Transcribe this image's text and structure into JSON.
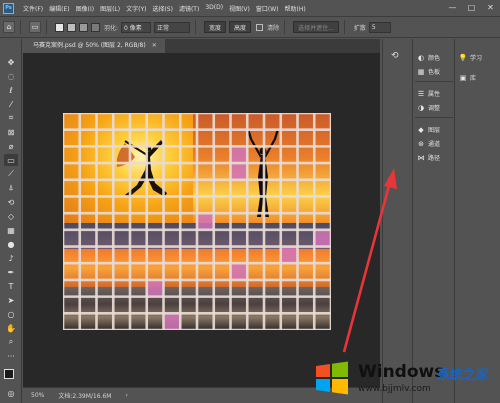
{
  "app": {
    "logo": "Ps"
  },
  "menu": [
    "文件(F)",
    "编辑(E)",
    "图像(I)",
    "图层(L)",
    "文字(Y)",
    "选择(S)",
    "滤镜(T)",
    "3D(D)",
    "视图(V)",
    "窗口(W)",
    "帮助(H)"
  ],
  "window_controls": [
    "—",
    "□",
    "✕"
  ],
  "options_bar": {
    "feather_label": "羽化:",
    "feather_value": "0 像素",
    "style_value": "正常",
    "width_label": "宽度",
    "height_label": "高度",
    "clear_label": "清除",
    "select_subject": "选择并遮住...",
    "expand_label": "扩散",
    "expand_value": "5"
  },
  "document_tab": {
    "title": "马赛克案例.psd @ 50% (图层 2, RGB/8)",
    "close": "✕"
  },
  "tools": [
    "move-tool",
    "marquee-tool",
    "lasso-tool",
    "magic-wand-tool",
    "crop-tool",
    "frame-tool",
    "eyedropper-tool",
    "brush-tool",
    "healing-tool",
    "clone-stamp-tool",
    "history-brush-tool",
    "eraser-tool",
    "gradient-tool",
    "blur-tool",
    "dodge-tool",
    "pen-tool",
    "type-tool",
    "path-select-tool",
    "shape-tool",
    "hand-tool",
    "zoom-tool",
    "more-tools"
  ],
  "panels": {
    "group1": [
      {
        "icon": "color-icon",
        "label": "颜色"
      },
      {
        "icon": "swatches-icon",
        "label": "色板"
      }
    ],
    "group2": [
      {
        "icon": "properties-icon",
        "label": "属性"
      },
      {
        "icon": "adjustments-icon",
        "label": "调整"
      }
    ],
    "group3": [
      {
        "icon": "layers-icon",
        "label": "图层"
      },
      {
        "icon": "channels-icon",
        "label": "通道"
      },
      {
        "icon": "paths-icon",
        "label": "路径"
      }
    ],
    "group4": [
      {
        "icon": "learn-icon",
        "label": "学习"
      },
      {
        "icon": "libraries-icon",
        "label": "库"
      }
    ]
  },
  "status_bar": {
    "zoom": "50%",
    "doc_info": "文档:2.39M/16.6M",
    "arrow": "›"
  },
  "watermark": {
    "title": "Windows",
    "subtitle": "系统之家",
    "url": "www.bjjmlv.com"
  },
  "colors": {
    "ui_bg": "#535353",
    "canvas_bg": "#282828",
    "arrow": "#e8353a",
    "grid_line": "#e8dcd6",
    "pink_tile": "#d173b9"
  }
}
